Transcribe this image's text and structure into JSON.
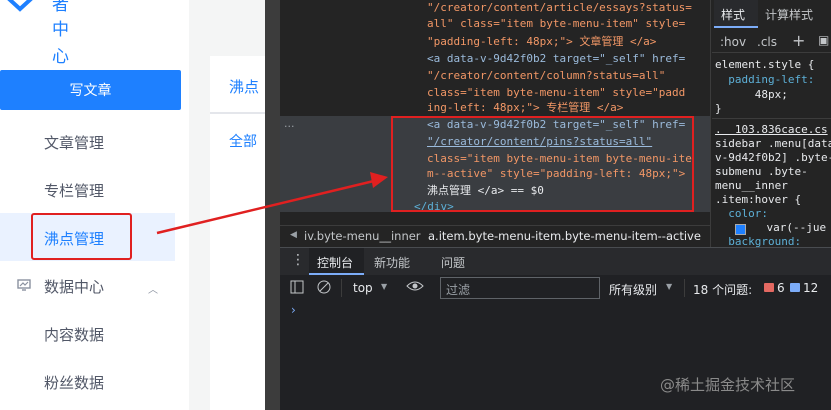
{
  "sidebar": {
    "brand_chars": [
      "者",
      "中",
      "心"
    ],
    "write_button": "写文章",
    "items": [
      {
        "label": "文章管理"
      },
      {
        "label": "专栏管理"
      },
      {
        "label": "沸点管理",
        "active": true
      },
      {
        "label": "数据中心",
        "icon": "chart-icon",
        "expanded": true
      },
      {
        "label": "内容数据"
      },
      {
        "label": "粉丝数据"
      }
    ]
  },
  "content": {
    "tab": "沸点",
    "filter": "全部"
  },
  "elements": {
    "lines": [
      {
        "text": "\"/creator/content/article/essays?status="
      },
      {
        "text": "all\" class=\"item byte-menu-item\" style="
      },
      {
        "text": "\"padding-left: 48px;\"> 文章管理 </a>"
      },
      {
        "text": "<a data-v-9d42f0b2 target=\"_self\" href="
      },
      {
        "text": "\"/creator/content/column?status=all\""
      },
      {
        "text": "class=\"item byte-menu-item\" style=\"padd"
      },
      {
        "text": "ing-left: 48px;\"> 专栏管理 </a>"
      },
      {
        "text": "<a data-v-9d42f0b2 target=\"_self\" href="
      },
      {
        "text": "\"/creator/content/pins?status=all\""
      },
      {
        "text": "class=\"item byte-menu-item byte-menu-ite"
      },
      {
        "text": "m--active\" style=\"padding-left: 48px;\">"
      },
      {
        "text": "沸点管理 </a> == $0"
      },
      {
        "text": "</div>"
      }
    ],
    "ellipsis": "...",
    "breadcrumbs": [
      "iv.byte-menu__inner",
      "a.item.byte-menu-item.byte-menu-item--active"
    ]
  },
  "styles": {
    "tabs": [
      "样式",
      "计算样式"
    ],
    "filter_hov": ":hov",
    "filter_cls": ".cls",
    "lines": [
      "element.style {",
      "  padding-left:",
      "      48px;",
      "}",
      ".  103.836cace.cs",
      "sidebar .menu[data",
      "v-9d42f0b2] .byte-",
      "submenu .byte-",
      "menu__inner",
      ".item:hover {",
      "  color:",
      "    var(--jue",
      "  background:"
    ]
  },
  "console": {
    "tabs": [
      "控制台",
      "新功能",
      "问题"
    ],
    "context": "top",
    "filter_placeholder": "过滤",
    "levels": "所有级别",
    "issues_label": "18 个问题:",
    "error_count": "6",
    "info_count": "12",
    "prompt": "›"
  },
  "watermark": "@稀土掘金技术社区",
  "colors": {
    "brand_blue": "#1e80ff",
    "highlight_red": "#e02020",
    "devtools_bg": "#202124"
  }
}
